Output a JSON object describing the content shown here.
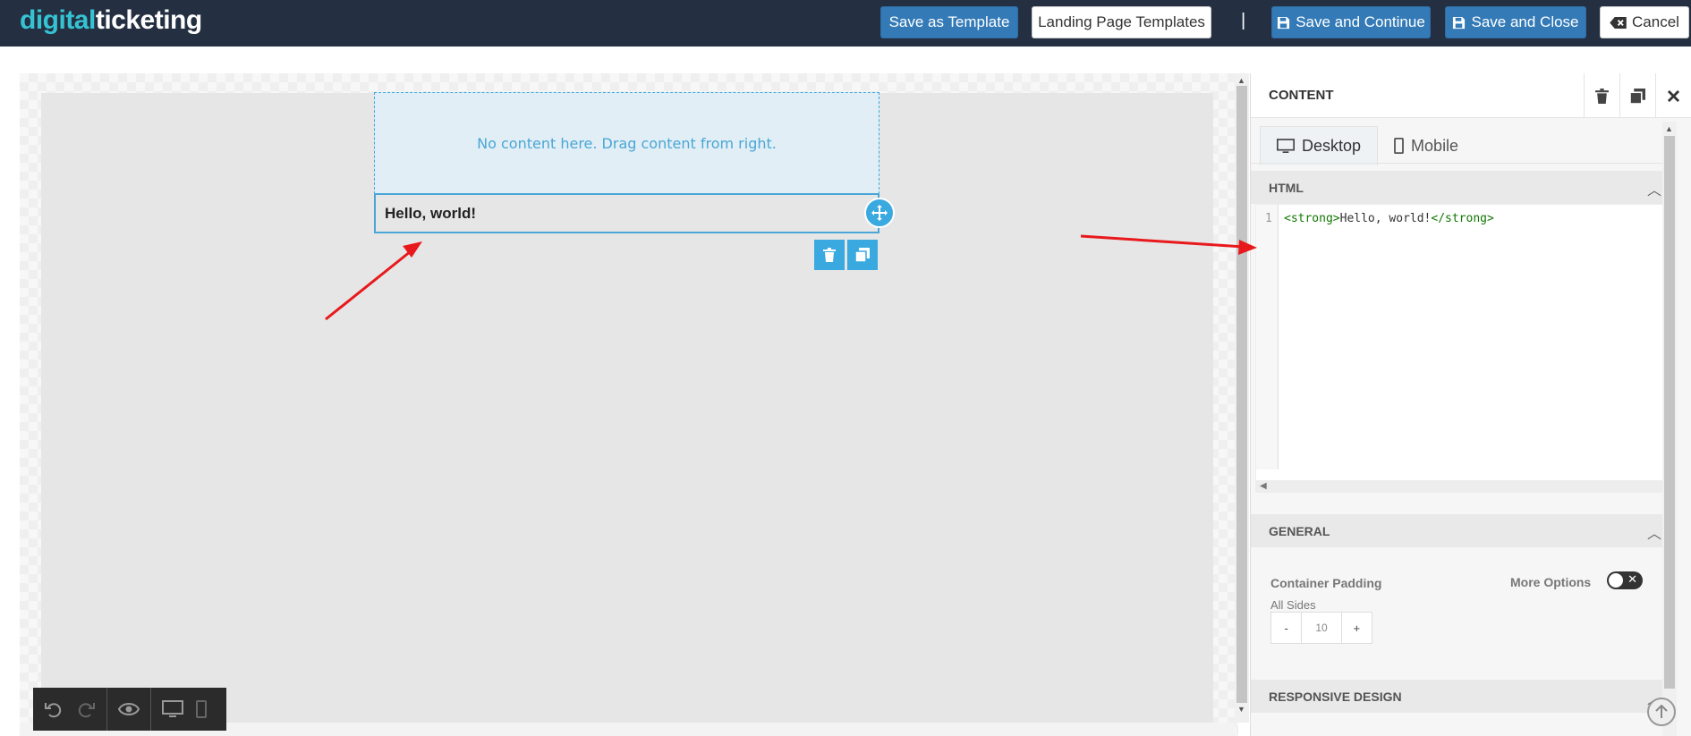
{
  "app": {
    "logo_part1": "digital",
    "logo_part2": "ticketing"
  },
  "toolbar": {
    "save_template": "Save as Template",
    "landing_templates": "Landing Page Templates",
    "separator": "|",
    "save_continue": "Save and Continue",
    "save_close": "Save and Close",
    "cancel": "Cancel"
  },
  "canvas": {
    "dropzone_text": "No content here. Drag content from right.",
    "text_block": "Hello, world!"
  },
  "panel": {
    "title": "CONTENT",
    "tabs": [
      {
        "label": "Desktop",
        "active": true,
        "icon": "desktop-icon"
      },
      {
        "label": "Mobile",
        "active": false,
        "icon": "mobile-icon"
      }
    ],
    "html_section": {
      "title": "HTML",
      "line_number": "1",
      "code_open_tag": "<strong>",
      "code_text": "Hello, world!",
      "code_close_tag": "</strong>"
    },
    "general_section": {
      "title": "GENERAL",
      "container_padding_label": "Container Padding",
      "more_options_label": "More Options",
      "all_sides_label": "All Sides",
      "minus": "-",
      "padding_value": "10",
      "plus": "+"
    },
    "responsive_section": {
      "title": "RESPONSIVE DESIGN"
    }
  },
  "colors": {
    "topbar": "#243042",
    "primary_button": "#337ab7",
    "accent": "#39a9e0",
    "annotation_arrow": "#e8191c"
  }
}
